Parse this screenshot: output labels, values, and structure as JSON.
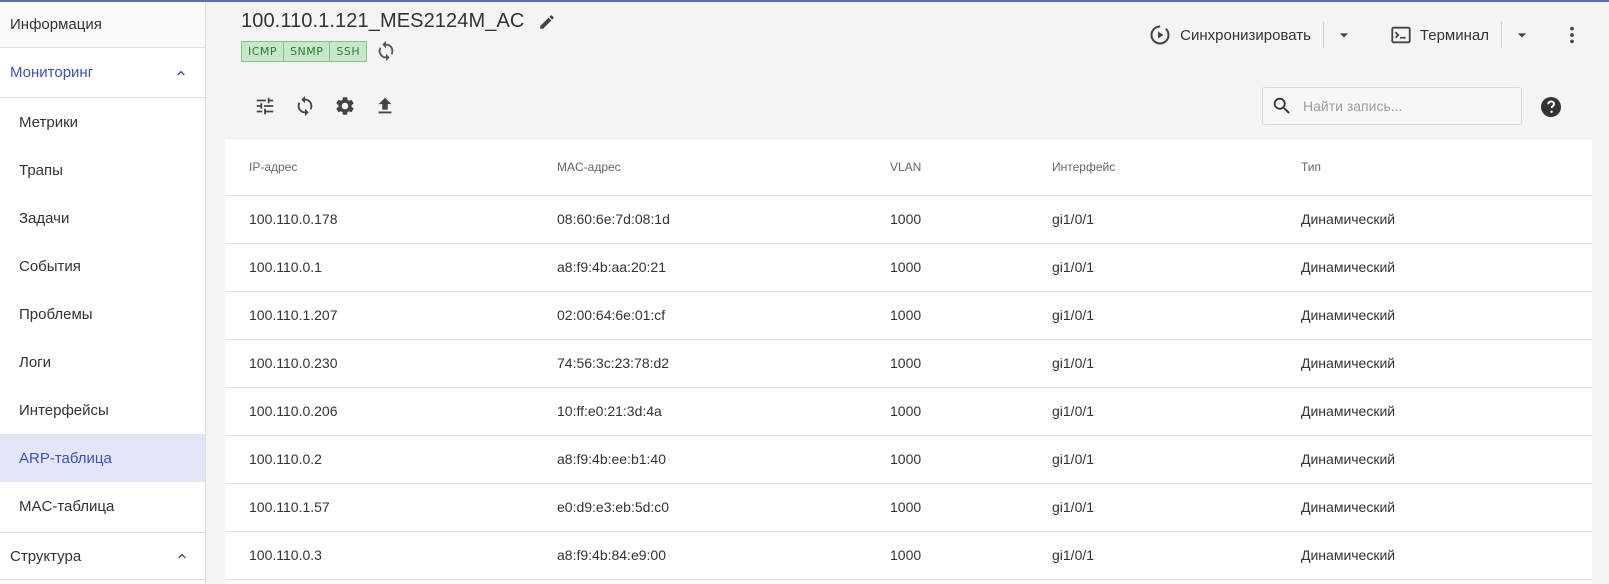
{
  "sidebar": {
    "info_label": "Информация",
    "monitoring_label": "Мониторинг",
    "items": [
      {
        "label": "Метрики"
      },
      {
        "label": "Трапы"
      },
      {
        "label": "Задачи"
      },
      {
        "label": "События"
      },
      {
        "label": "Проблемы"
      },
      {
        "label": "Логи"
      },
      {
        "label": "Интерфейсы"
      },
      {
        "label": "ARP-таблица"
      },
      {
        "label": "MAC-таблица"
      }
    ],
    "structure_label": "Структура"
  },
  "header": {
    "title": "100.110.1.121_MES2124M_AC",
    "badges": [
      "ICMP",
      "SNMP",
      "SSH"
    ],
    "sync_label": "Синхронизировать",
    "terminal_label": "Терминал"
  },
  "toolbar": {
    "search_placeholder": "Найти запись..."
  },
  "table": {
    "headers": [
      "IP-адрес",
      "MAC-адрес",
      "VLAN",
      "Интерфейс",
      "Тип"
    ],
    "rows": [
      [
        "100.110.0.178",
        "08:60:6e:7d:08:1d",
        "1000",
        "gi1/0/1",
        "Динамический"
      ],
      [
        "100.110.0.1",
        "a8:f9:4b:aa:20:21",
        "1000",
        "gi1/0/1",
        "Динамический"
      ],
      [
        "100.110.1.207",
        "02:00:64:6e:01:cf",
        "1000",
        "gi1/0/1",
        "Динамический"
      ],
      [
        "100.110.0.230",
        "74:56:3c:23:78:d2",
        "1000",
        "gi1/0/1",
        "Динамический"
      ],
      [
        "100.110.0.206",
        "10:ff:e0:21:3d:4a",
        "1000",
        "gi1/0/1",
        "Динамический"
      ],
      [
        "100.110.0.2",
        "a8:f9:4b:ee:b1:40",
        "1000",
        "gi1/0/1",
        "Динамический"
      ],
      [
        "100.110.1.57",
        "e0:d9:e3:eb:5d:c0",
        "1000",
        "gi1/0/1",
        "Динамический"
      ],
      [
        "100.110.0.3",
        "a8:f9:4b:84:e9:00",
        "1000",
        "gi1/0/1",
        "Динамический"
      ]
    ]
  },
  "colors": {
    "accent": "#3f51b5",
    "selected_bg": "#e3e6f6",
    "badge_bg": "#c8e6c9",
    "badge_text": "#2e7d32"
  },
  "icons": {
    "edit": "pencil-icon",
    "refresh": "refresh-icon",
    "sync": "sync-play-icon",
    "terminal": "terminal-icon",
    "more": "more-vert-icon",
    "filter": "tune-icon",
    "settings": "gear-icon",
    "upload": "upload-icon",
    "search": "search-icon",
    "help": "help-icon",
    "chevron_up": "chevron-up-icon",
    "dropdown": "caret-down-icon"
  }
}
